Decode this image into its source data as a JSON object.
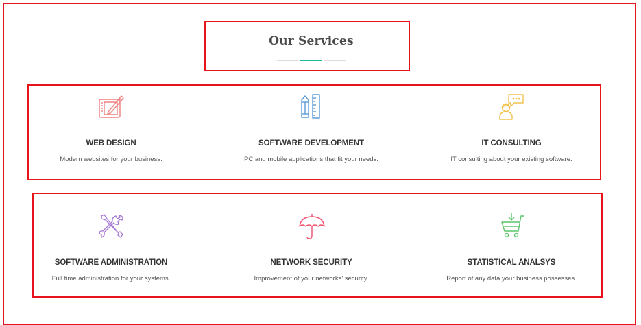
{
  "section": {
    "title": "Our Services"
  },
  "services": [
    {
      "name": "WEB DESIGN",
      "description": "Modern websites for your business.",
      "icon": "tablet-drawing-icon",
      "color": "#f08080"
    },
    {
      "name": "SOFTWARE DEVELOPMENT",
      "description": "PC and mobile applications that fit your needs.",
      "icon": "pencil-ruler-icon",
      "color": "#5b9bd5"
    },
    {
      "name": "IT CONSULTING",
      "description": "IT consulting about your existing software.",
      "icon": "consultant-chat-icon",
      "color": "#f0c14b"
    },
    {
      "name": "SOFTWARE ADMINISTRATION",
      "description": "Full time administration for your systems.",
      "icon": "wrench-screwdriver-icon",
      "color": "#a678d6"
    },
    {
      "name": "NETWORK SECURITY",
      "description": "Improvement of your networks' security.",
      "icon": "umbrella-icon",
      "color": "#f0506e"
    },
    {
      "name": "STATISTICAL ANALSYS",
      "description": "Report of any data your business possesses.",
      "icon": "cart-download-icon",
      "color": "#5cc46b"
    }
  ],
  "colors": {
    "accent": "#1fb59a",
    "highlight_border": "#e8141c"
  }
}
